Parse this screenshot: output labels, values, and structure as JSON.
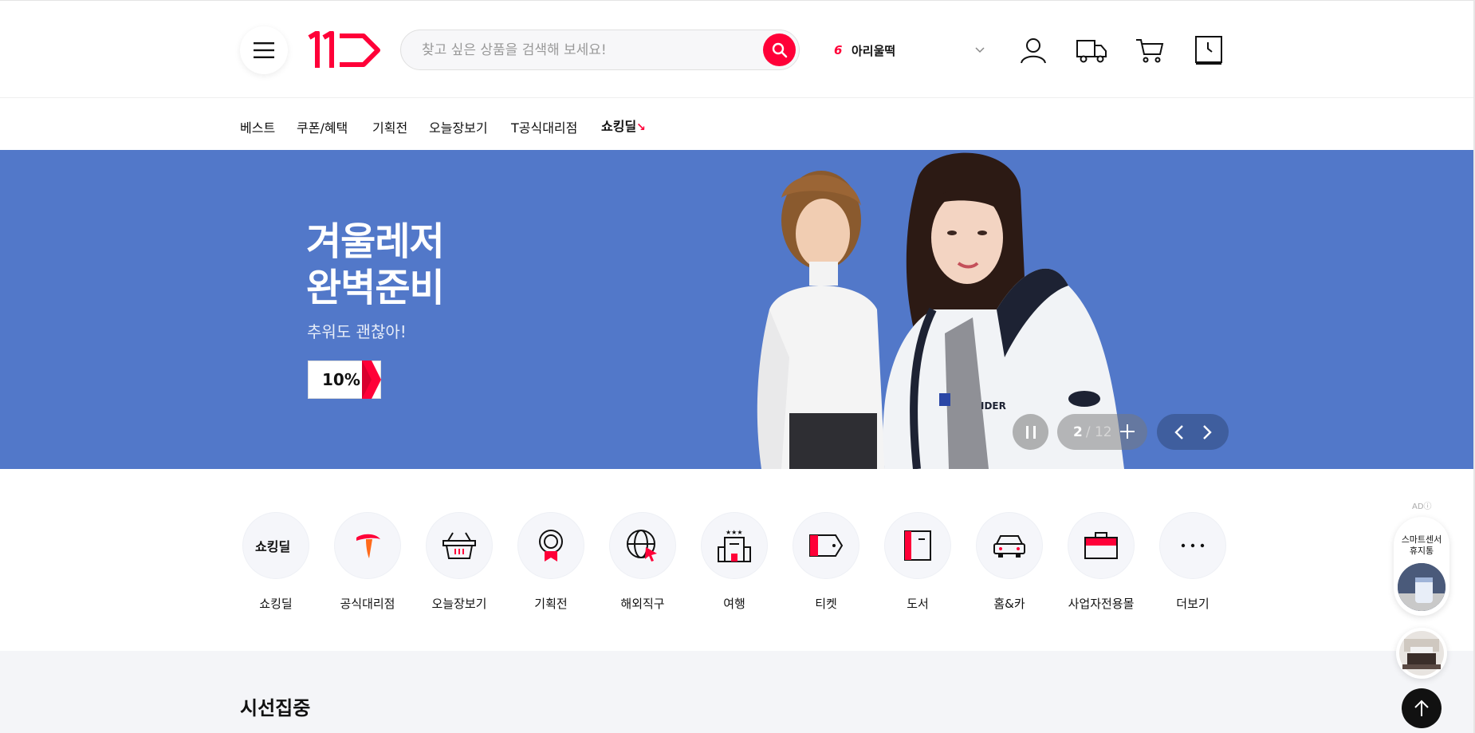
{
  "header": {
    "search_placeholder": "찾고 싶은 상품을 검색해 보세요!",
    "rank_number": "6",
    "rank_keyword": "아리울떡"
  },
  "nav": {
    "items": [
      "베스트",
      "쿠폰/혜택",
      "기획전",
      "오늘장보기",
      "T공식대리점"
    ],
    "deal_label": "쇼킹딜"
  },
  "hero": {
    "title_line1": "겨울레저",
    "title_line2": "완벽준비",
    "subtitle": "추워도 괜찮아!",
    "badge": "10%",
    "slide_current": "2",
    "slide_total": "/ 12"
  },
  "categories": [
    {
      "label": "쇼킹딜",
      "icon": "shocking-deal-logo"
    },
    {
      "label": "공식대리점",
      "icon": "t-logo-icon"
    },
    {
      "label": "오늘장보기",
      "icon": "basket-icon"
    },
    {
      "label": "기획전",
      "icon": "medal-icon"
    },
    {
      "label": "해외직구",
      "icon": "globe-icon"
    },
    {
      "label": "여행",
      "icon": "hotel-icon"
    },
    {
      "label": "티켓",
      "icon": "ticket-icon"
    },
    {
      "label": "도서",
      "icon": "book-icon"
    },
    {
      "label": "홈&카",
      "icon": "car-icon"
    },
    {
      "label": "사업자전용몰",
      "icon": "briefcase-icon"
    },
    {
      "label": "더보기",
      "icon": "more-icon"
    }
  ],
  "side": {
    "ad_label": "AD",
    "card_line1": "스마트센서",
    "card_line2": "휴지통"
  },
  "section": {
    "title": "시선집중"
  },
  "colors": {
    "brand_red": "#ff0038",
    "hero_bg": "#5278c9"
  }
}
